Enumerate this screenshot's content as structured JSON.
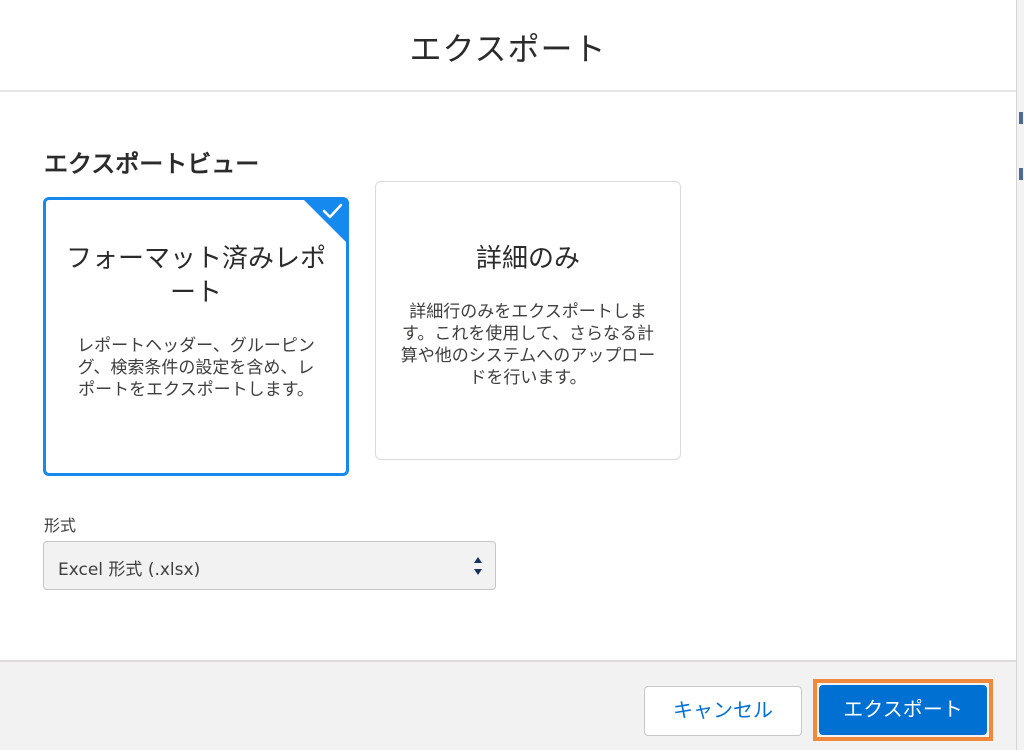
{
  "dialog": {
    "title": "エクスポート"
  },
  "export_view": {
    "heading": "エクスポートビュー",
    "options": [
      {
        "title": "フォーマット済みレポート",
        "description": "レポートヘッダー、グルーピング、検索条件の設定を含め、レポートをエクスポートします。",
        "selected": true
      },
      {
        "title": "詳細のみ",
        "description": "詳細行のみをエクスポートします。これを使用して、さらなる計算や他のシステムへのアップロードを行います。",
        "selected": false
      }
    ]
  },
  "format": {
    "label": "形式",
    "selected_value": "Excel 形式 (.xlsx)"
  },
  "footer": {
    "cancel_label": "キャンセル",
    "export_label": "エクスポート"
  },
  "colors": {
    "accent": "#1589ee",
    "primary_button": "#0070d2",
    "highlight_outline": "#ef8a3c"
  }
}
